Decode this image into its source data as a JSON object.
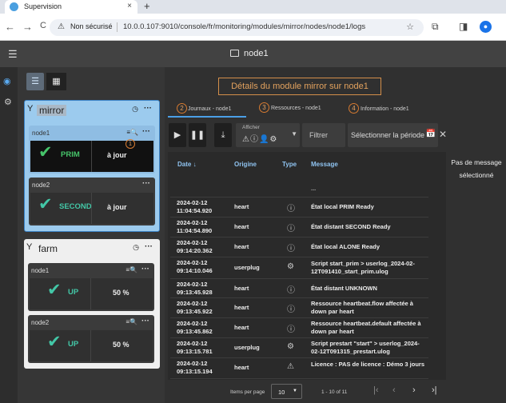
{
  "browser": {
    "tab_title": "Supervision",
    "tab_close": "×",
    "new_tab": "+",
    "security_label": "Non sécurisé",
    "url": "10.0.0.107:9010/console/fr/monitoring/modules/mirror/nodes/node1/logs",
    "nav": {
      "back": "←",
      "forward": "→",
      "reload": "C"
    }
  },
  "app": {
    "node_title": "node1",
    "heading": "Détails du module mirror sur node1",
    "tabs": [
      {
        "num": "2",
        "label": "Journaux - node1"
      },
      {
        "num": "3",
        "label": "Ressources - node1"
      },
      {
        "num": "4",
        "label": "Information - node1"
      }
    ]
  },
  "groups": [
    {
      "name": "mirror",
      "nodes": [
        {
          "name": "node1",
          "role": "PRIM",
          "state": "à jour"
        },
        {
          "name": "node2",
          "role": "SECOND",
          "state": "à jour"
        }
      ]
    },
    {
      "name": "farm",
      "nodes": [
        {
          "name": "node1",
          "role": "UP",
          "state": "50 %"
        },
        {
          "name": "node2",
          "role": "UP",
          "state": "50 %"
        }
      ]
    }
  ],
  "badge": "1",
  "toolbar": {
    "show_label": "Afficher",
    "filter_placeholder": "Filtrer",
    "period_placeholder": "Sélectionner la période"
  },
  "table": {
    "headers": {
      "date": "Date ↓",
      "origin": "Origine",
      "type": "Type",
      "message": "Message"
    },
    "ellipsis_row": "...",
    "rows": [
      {
        "date": "2024-02-12 11:04:54.920",
        "origin": "heart",
        "type": "info",
        "message": "État local PRIM Ready"
      },
      {
        "date": "2024-02-12 11:04:54.890",
        "origin": "heart",
        "type": "info",
        "message": "État distant SECOND Ready"
      },
      {
        "date": "2024-02-12 09:14:20.362",
        "origin": "heart",
        "type": "info",
        "message": "État local ALONE Ready"
      },
      {
        "date": "2024-02-12 09:14:10.046",
        "origin": "userplug",
        "type": "gear",
        "message": "Script start_prim > userlog_2024-02-12T091410_start_prim.ulog"
      },
      {
        "date": "2024-02-12 09:13:45.928",
        "origin": "heart",
        "type": "info",
        "message": "État distant UNKNOWN"
      },
      {
        "date": "2024-02-12 09:13:45.922",
        "origin": "heart",
        "type": "info",
        "message": "Ressource heartbeat.flow affectée à down par heart"
      },
      {
        "date": "2024-02-12 09:13:45.862",
        "origin": "heart",
        "type": "info",
        "message": "Ressource heartbeat.default affectée à down par heart"
      },
      {
        "date": "2024-02-12 09:13:15.781",
        "origin": "userplug",
        "type": "gear",
        "message": "Script prestart \"start\" > userlog_2024-02-12T091315_prestart.ulog"
      },
      {
        "date": "2024-02-12 09:13:15.194",
        "origin": "heart",
        "type": "warning",
        "message": "Licence : PAS de licence : Démo 3 jours"
      }
    ]
  },
  "pagination": {
    "items_label": "Items per page",
    "page_size": "10",
    "range": "1 - 10 of 11"
  },
  "detail": {
    "empty_message": "Pas de message sélectionné"
  },
  "colors": {
    "accent": "#4b9fe6",
    "step": "#d67a30",
    "ok": "#46c46a"
  }
}
